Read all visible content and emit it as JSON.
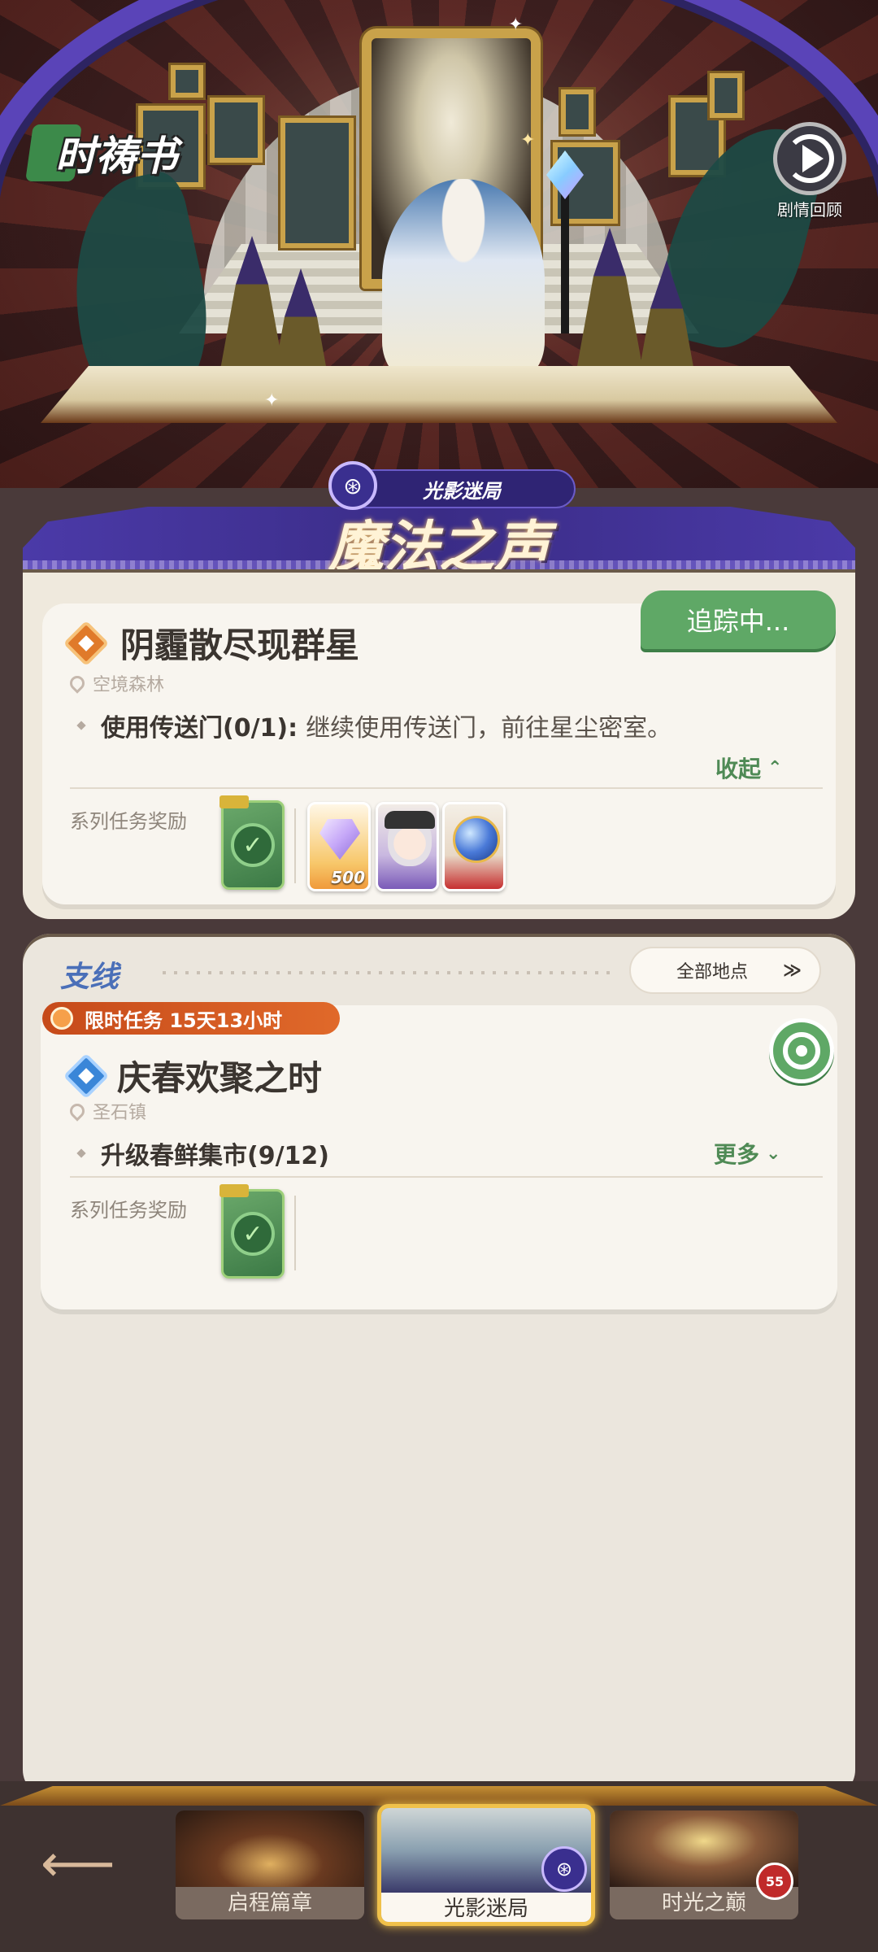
{
  "hero": {
    "logo_text": "时祷书",
    "replay_label": "剧情回顾"
  },
  "chapter": {
    "subtitle": "光影迷局",
    "title": "魔法之声"
  },
  "main_quest": {
    "tracking_label": "追踪中...",
    "title": "阴霾散尽现群星",
    "location": "空境森林",
    "objective_label": "使用传送门(0/1):",
    "objective_text": "继续使用传送门，前往星尘密室。",
    "collapse_label": "收起",
    "rewards_label": "系列任务奖励",
    "rewards": [
      {
        "type": "chest",
        "icon": "check-chest-icon"
      },
      {
        "type": "diamond",
        "icon": "diamond-icon",
        "qty": "500"
      },
      {
        "type": "avatar",
        "icon": "character-avatar-icon"
      },
      {
        "type": "orb",
        "icon": "crystal-orb-icon"
      }
    ]
  },
  "side_section": {
    "title": "支线",
    "filter_label": "全部地点"
  },
  "side_quest": {
    "limited_label": "限时任务 15天13小时",
    "title": "庆春欢聚之时",
    "location": "圣石镇",
    "objective_label": "升级春鲜集市(9/12)",
    "more_label": "更多",
    "rewards_label": "系列任务奖励"
  },
  "bottom_nav": {
    "tabs": [
      {
        "label": "启程篇章"
      },
      {
        "label": "光影迷局",
        "active": true
      },
      {
        "label": "时光之巅"
      }
    ],
    "lock_badge": "55"
  },
  "colors": {
    "accent_green": "#5fa866",
    "chapter_purple": "#4b3aa8",
    "limited_orange": "#d8581f",
    "active_gold": "#f0c14a"
  }
}
